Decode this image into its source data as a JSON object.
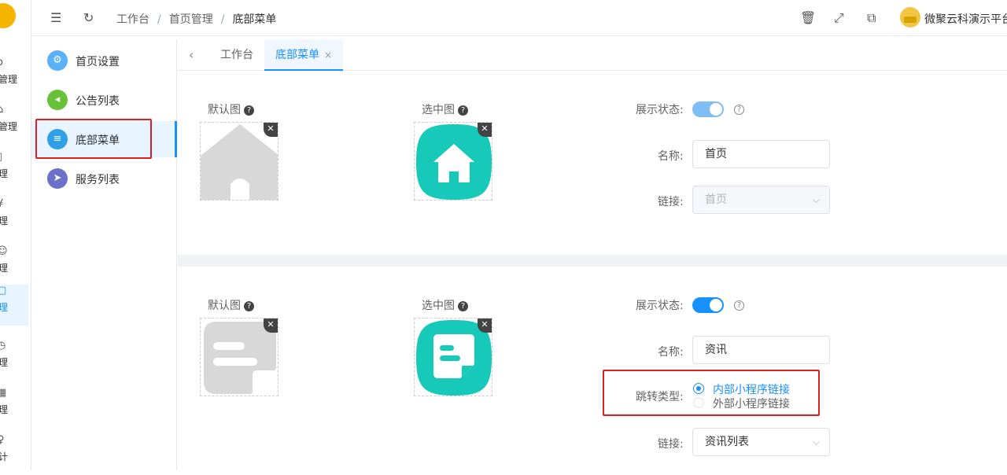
{
  "rail": {
    "items": [
      {
        "icon": "o",
        "label": "员管理"
      },
      {
        "icon": "⌂",
        "label": "站管理"
      },
      {
        "icon": "▯",
        "label": "管理"
      },
      {
        "icon": "¥",
        "label": "管理"
      },
      {
        "icon": "☺",
        "label": "管理"
      },
      {
        "icon": "▢",
        "label": "管理"
      },
      {
        "icon": "◷",
        "label": "管理"
      },
      {
        "icon": "▦",
        "label": "管理"
      },
      {
        "icon": "♀",
        "label": "统计"
      }
    ]
  },
  "header": {
    "breadcrumb": [
      "工作台",
      "首页管理",
      "底部菜单"
    ],
    "user_name": "微聚云科演示平台"
  },
  "submenu": {
    "items": [
      {
        "label": "首页设置",
        "color": "#5bb1f8",
        "icon": "gear-icon"
      },
      {
        "label": "公告列表",
        "color": "#67c23a",
        "icon": "speaker-icon"
      },
      {
        "label": "底部菜单",
        "color": "#2ea0e8",
        "icon": "list-icon"
      },
      {
        "label": "服务列表",
        "color": "#6b70c9",
        "icon": "send-icon"
      }
    ]
  },
  "tabs": [
    {
      "label": "工作台"
    },
    {
      "label": "底部菜单",
      "close": "×"
    }
  ],
  "menu_items": [
    {
      "default_label": "默认图",
      "selected_label": "选中图",
      "status_label": "展示状态:",
      "name_label": "名称:",
      "name_value": "首页",
      "link_label": "链接:",
      "link_value": "首页"
    },
    {
      "default_label": "默认图",
      "selected_label": "选中图",
      "status_label": "展示状态:",
      "name_label": "名称:",
      "name_value": "资讯",
      "jump_label": "跳转类型:",
      "jump_options": [
        "内部小程序链接",
        "外部小程序链接"
      ],
      "link_label": "链接:",
      "link_value": "资讯列表"
    }
  ],
  "colors": {
    "accent": "#1890ff",
    "teal": "#17c9b8",
    "highlight": "#e02020"
  }
}
